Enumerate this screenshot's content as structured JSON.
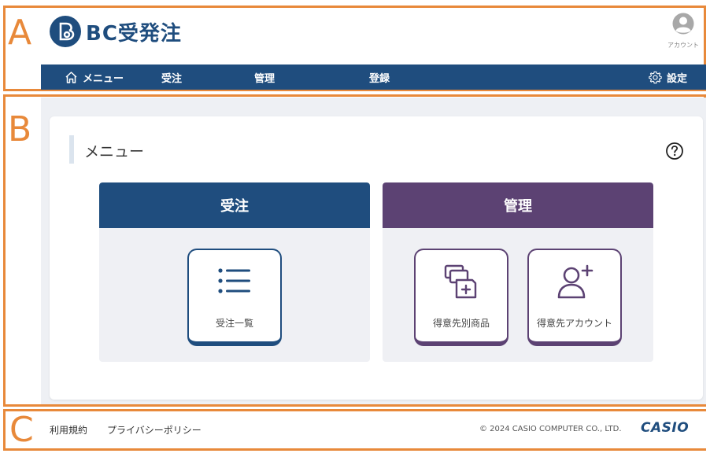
{
  "regions": {
    "a": "A",
    "b": "B",
    "c": "C"
  },
  "header": {
    "logo_text": "BC受発注",
    "account_label": "アカウント"
  },
  "nav": {
    "items": [
      {
        "label": "メニュー",
        "icon": "home-icon"
      },
      {
        "label": "受注"
      },
      {
        "label": "管理"
      },
      {
        "label": "登録"
      }
    ],
    "settings_label": "設定",
    "settings_icon": "gear-icon"
  },
  "main": {
    "page_title": "メニュー",
    "help_icon": "question-circle-icon",
    "sections": [
      {
        "title": "受注",
        "color": "#1f4d7e",
        "tiles": [
          {
            "label": "受注一覧",
            "icon": "list-icon"
          }
        ]
      },
      {
        "title": "管理",
        "color": "#5c4273",
        "tiles": [
          {
            "label": "得意先別商品",
            "icon": "products-icon"
          },
          {
            "label": "得意先アカウント",
            "icon": "add-user-icon"
          }
        ]
      }
    ]
  },
  "footer": {
    "terms": "利用規約",
    "privacy": "プライバシーポリシー",
    "copyright": "© 2024 CASIO COMPUTER CO., LTD.",
    "brand": "CASIO"
  },
  "colors": {
    "primary": "#1f4d7e",
    "secondary": "#5c4273",
    "annotation": "#e8893a"
  }
}
